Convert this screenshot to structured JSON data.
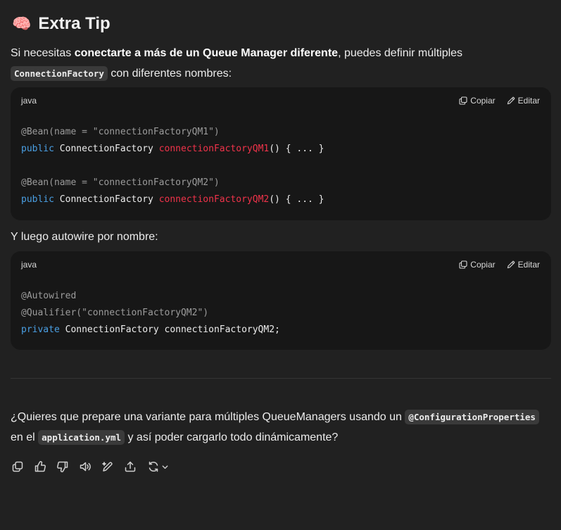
{
  "heading": {
    "emoji": "🧠",
    "title": "Extra Tip"
  },
  "intro": {
    "text_before": "Si necesitas ",
    "bold": "conectarte a más de un Queue Manager diferente",
    "text_after": ", puedes definir múltiples",
    "code": "ConnectionFactory",
    "text_end": " con diferentes nombres:"
  },
  "code_block_1": {
    "language": "java",
    "copy_label": "Copiar",
    "edit_label": "Editar",
    "lines": [
      {
        "anno": "@Bean(name = \"connectionFactoryQM1\")"
      },
      {
        "kw": "public",
        "type": " ConnectionFactory ",
        "fn": "connectionFactoryQM1",
        "rest": "() { ... }"
      },
      {
        "blank": ""
      },
      {
        "anno": "@Bean(name = \"connectionFactoryQM2\")"
      },
      {
        "kw": "public",
        "type": " ConnectionFactory ",
        "fn": "connectionFactoryQM2",
        "rest": "() { ... }"
      }
    ]
  },
  "middle_text": "Y luego autowire por nombre:",
  "code_block_2": {
    "language": "java",
    "copy_label": "Copiar",
    "edit_label": "Editar",
    "line1": "@Autowired",
    "line2": "@Qualifier(\"connectionFactoryQM2\")",
    "line3_kw": "private",
    "line3_rest": " ConnectionFactory connectionFactoryQM2;"
  },
  "question": {
    "text_before": "¿Quieres que prepare una variante para múltiples QueueManagers usando un ",
    "code1": "@ConfigurationProperties",
    "text_mid": " en el ",
    "code2": "application.yml",
    "text_after": " y así poder cargarlo todo dinámicamente?"
  },
  "toolbar_icons": [
    "copy-icon",
    "thumbs-up-icon",
    "thumbs-down-icon",
    "read-aloud-icon",
    "edit-canvas-icon",
    "share-icon",
    "regenerate-icon",
    "chevron-down-icon"
  ],
  "colors": {
    "background": "#212121",
    "code_background": "#171717",
    "keyword": "#4a9fe3",
    "function_name": "#f0334a",
    "annotation": "#9b9b9b"
  }
}
